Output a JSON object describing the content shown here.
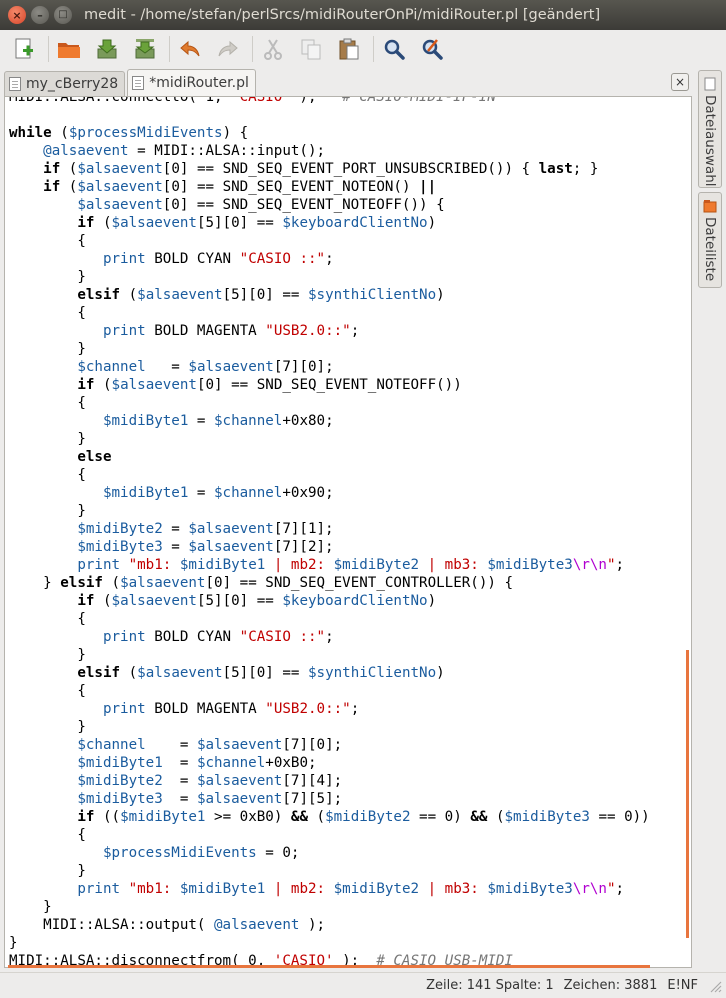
{
  "window": {
    "title": "medit - /home/stefan/perlSrcs/midiRouterOnPi/midiRouter.pl [geändert]",
    "close_glyph": "×",
    "min_glyph": "–",
    "max_glyph": "□"
  },
  "toolbar": {
    "icons": [
      "new-document-icon",
      "open-folder-icon",
      "save-icon",
      "save-as-icon",
      "undo-icon",
      "redo-icon",
      "cut-icon",
      "copy-icon",
      "paste-icon",
      "find-icon",
      "find-replace-icon"
    ]
  },
  "tabs": [
    {
      "label": "my_cBerry28"
    },
    {
      "label": "*midiRouter.pl"
    }
  ],
  "tab_close_glyph": "×",
  "side_panels": [
    {
      "label": "Dateiauswahl"
    },
    {
      "label": "Dateiliste"
    }
  ],
  "code_lines": [
    [
      [
        "",
        "MIDI::ALSA::connectto( 1, "
      ],
      [
        "str",
        "'CASIO'"
      ],
      [
        "",
        " );   "
      ],
      [
        "cmt",
        "# CASIO-MIDI-IF-IN"
      ]
    ],
    [],
    [
      [
        "kw",
        "while"
      ],
      [
        "",
        " ("
      ],
      [
        "var",
        "$processMidiEvents"
      ],
      [
        "",
        ") {"
      ]
    ],
    [
      [
        "",
        "    "
      ],
      [
        "var",
        "@alsaevent"
      ],
      [
        "",
        " = MIDI::ALSA::input();"
      ]
    ],
    [
      [
        "",
        "    "
      ],
      [
        "kw",
        "if"
      ],
      [
        "",
        " ("
      ],
      [
        "var",
        "$alsaevent"
      ],
      [
        "",
        "[0] == SND_SEQ_EVENT_PORT_UNSUBSCRIBED()) { "
      ],
      [
        "kw",
        "last"
      ],
      [
        "",
        "; }"
      ]
    ],
    [
      [
        "",
        "    "
      ],
      [
        "kw",
        "if"
      ],
      [
        "",
        " ("
      ],
      [
        "var",
        "$alsaevent"
      ],
      [
        "",
        "[0] == SND_SEQ_EVENT_NOTEON() "
      ],
      [
        "kw",
        "||"
      ]
    ],
    [
      [
        "",
        "        "
      ],
      [
        "var",
        "$alsaevent"
      ],
      [
        "",
        "[0] == SND_SEQ_EVENT_NOTEOFF()) {"
      ]
    ],
    [
      [
        "",
        "        "
      ],
      [
        "kw",
        "if"
      ],
      [
        "",
        " ("
      ],
      [
        "var",
        "$alsaevent"
      ],
      [
        "",
        "[5][0] == "
      ],
      [
        "var",
        "$keyboardClientNo"
      ],
      [
        "",
        ")"
      ]
    ],
    [
      [
        "",
        "        {"
      ]
    ],
    [
      [
        "",
        "           "
      ],
      [
        "var",
        "print"
      ],
      [
        "",
        " BOLD CYAN "
      ],
      [
        "str",
        "\"CASIO ::\""
      ],
      [
        "",
        ";"
      ]
    ],
    [
      [
        "",
        "        }"
      ]
    ],
    [
      [
        "",
        "        "
      ],
      [
        "kw",
        "elsif"
      ],
      [
        "",
        " ("
      ],
      [
        "var",
        "$alsaevent"
      ],
      [
        "",
        "[5][0] == "
      ],
      [
        "var",
        "$synthiClientNo"
      ],
      [
        "",
        ")"
      ]
    ],
    [
      [
        "",
        "        {"
      ]
    ],
    [
      [
        "",
        "           "
      ],
      [
        "var",
        "print"
      ],
      [
        "",
        " BOLD MAGENTA "
      ],
      [
        "str",
        "\"USB2.0::\""
      ],
      [
        "",
        ";"
      ]
    ],
    [
      [
        "",
        "        }"
      ]
    ],
    [
      [
        "",
        "        "
      ],
      [
        "var",
        "$channel"
      ],
      [
        "",
        "   = "
      ],
      [
        "var",
        "$alsaevent"
      ],
      [
        "",
        "[7][0];"
      ]
    ],
    [
      [
        "",
        "        "
      ],
      [
        "kw",
        "if"
      ],
      [
        "",
        " ("
      ],
      [
        "var",
        "$alsaevent"
      ],
      [
        "",
        "[0] == SND_SEQ_EVENT_NOTEOFF())"
      ]
    ],
    [
      [
        "",
        "        {"
      ]
    ],
    [
      [
        "",
        "           "
      ],
      [
        "var",
        "$midiByte1"
      ],
      [
        "",
        " = "
      ],
      [
        "var",
        "$channel"
      ],
      [
        "",
        "+0x80;"
      ]
    ],
    [
      [
        "",
        "        }"
      ]
    ],
    [
      [
        "",
        "        "
      ],
      [
        "kw",
        "else"
      ]
    ],
    [
      [
        "",
        "        {"
      ]
    ],
    [
      [
        "",
        "           "
      ],
      [
        "var",
        "$midiByte1"
      ],
      [
        "",
        " = "
      ],
      [
        "var",
        "$channel"
      ],
      [
        "",
        "+0x90;"
      ]
    ],
    [
      [
        "",
        "        }"
      ]
    ],
    [
      [
        "",
        "        "
      ],
      [
        "var",
        "$midiByte2"
      ],
      [
        "",
        " = "
      ],
      [
        "var",
        "$alsaevent"
      ],
      [
        "",
        "[7][1];"
      ]
    ],
    [
      [
        "",
        "        "
      ],
      [
        "var",
        "$midiByte3"
      ],
      [
        "",
        " = "
      ],
      [
        "var",
        "$alsaevent"
      ],
      [
        "",
        "[7][2];"
      ]
    ],
    [
      [
        "",
        "        "
      ],
      [
        "var",
        "print"
      ],
      [
        "",
        ""
      ],
      [
        "str",
        " \"mb1: "
      ],
      [
        "var",
        "$midiByte1"
      ],
      [
        "str",
        " | mb2: "
      ],
      [
        "var",
        "$midiByte2"
      ],
      [
        "str",
        " | mb3: "
      ],
      [
        "var",
        "$midiByte3"
      ],
      [
        "esc",
        "\\r\\n"
      ],
      [
        "str",
        "\""
      ],
      [
        "",
        ";"
      ]
    ],
    [
      [
        "",
        "    } "
      ],
      [
        "kw",
        "elsif"
      ],
      [
        "",
        " ("
      ],
      [
        "var",
        "$alsaevent"
      ],
      [
        "",
        "[0] == SND_SEQ_EVENT_CONTROLLER()) {"
      ]
    ],
    [
      [
        "",
        "        "
      ],
      [
        "kw",
        "if"
      ],
      [
        "",
        " ("
      ],
      [
        "var",
        "$alsaevent"
      ],
      [
        "",
        "[5][0] == "
      ],
      [
        "var",
        "$keyboardClientNo"
      ],
      [
        "",
        ")"
      ]
    ],
    [
      [
        "",
        "        {"
      ]
    ],
    [
      [
        "",
        "           "
      ],
      [
        "var",
        "print"
      ],
      [
        "",
        " BOLD CYAN "
      ],
      [
        "str",
        "\"CASIO ::\""
      ],
      [
        "",
        ";"
      ]
    ],
    [
      [
        "",
        "        }"
      ]
    ],
    [
      [
        "",
        "        "
      ],
      [
        "kw",
        "elsif"
      ],
      [
        "",
        " ("
      ],
      [
        "var",
        "$alsaevent"
      ],
      [
        "",
        "[5][0] == "
      ],
      [
        "var",
        "$synthiClientNo"
      ],
      [
        "",
        ")"
      ]
    ],
    [
      [
        "",
        "        {"
      ]
    ],
    [
      [
        "",
        "           "
      ],
      [
        "var",
        "print"
      ],
      [
        "",
        " BOLD MAGENTA "
      ],
      [
        "str",
        "\"USB2.0::\""
      ],
      [
        "",
        ";"
      ]
    ],
    [
      [
        "",
        "        }"
      ]
    ],
    [
      [
        "",
        "        "
      ],
      [
        "var",
        "$channel"
      ],
      [
        "",
        "    = "
      ],
      [
        "var",
        "$alsaevent"
      ],
      [
        "",
        "[7][0];"
      ]
    ],
    [
      [
        "",
        "        "
      ],
      [
        "var",
        "$midiByte1"
      ],
      [
        "",
        "  = "
      ],
      [
        "var",
        "$channel"
      ],
      [
        "",
        "+0xB0;"
      ]
    ],
    [
      [
        "",
        "        "
      ],
      [
        "var",
        "$midiByte2"
      ],
      [
        "",
        "  = "
      ],
      [
        "var",
        "$alsaevent"
      ],
      [
        "",
        "[7][4];"
      ]
    ],
    [
      [
        "",
        "        "
      ],
      [
        "var",
        "$midiByte3"
      ],
      [
        "",
        "  = "
      ],
      [
        "var",
        "$alsaevent"
      ],
      [
        "",
        "[7][5];"
      ]
    ],
    [
      [
        "",
        "        "
      ],
      [
        "kw",
        "if"
      ],
      [
        "",
        " (("
      ],
      [
        "var",
        "$midiByte1"
      ],
      [
        "",
        " >= 0xB0) "
      ],
      [
        "kw",
        "&&"
      ],
      [
        "",
        " ("
      ],
      [
        "var",
        "$midiByte2"
      ],
      [
        "",
        " == 0) "
      ],
      [
        "kw",
        "&&"
      ],
      [
        "",
        " ("
      ],
      [
        "var",
        "$midiByte3"
      ],
      [
        "",
        " == 0))"
      ]
    ],
    [
      [
        "",
        "        {"
      ]
    ],
    [
      [
        "",
        "           "
      ],
      [
        "var",
        "$processMidiEvents"
      ],
      [
        "",
        " = 0;"
      ]
    ],
    [
      [
        "",
        "        }"
      ]
    ],
    [
      [
        "",
        "        "
      ],
      [
        "var",
        "print"
      ],
      [
        "",
        ""
      ],
      [
        "str",
        " \"mb1: "
      ],
      [
        "var",
        "$midiByte1"
      ],
      [
        "str",
        " | mb2: "
      ],
      [
        "var",
        "$midiByte2"
      ],
      [
        "str",
        " | mb3: "
      ],
      [
        "var",
        "$midiByte3"
      ],
      [
        "esc",
        "\\r\\n"
      ],
      [
        "str",
        "\""
      ],
      [
        "",
        ";"
      ]
    ],
    [
      [
        "",
        "    }"
      ]
    ],
    [
      [
        "",
        "    MIDI::ALSA::output( "
      ],
      [
        "var",
        "@alsaevent"
      ],
      [
        "",
        " );"
      ]
    ],
    [
      [
        "",
        "}"
      ]
    ],
    [
      [
        "",
        "MIDI::ALSA::disconnectfrom( 0, "
      ],
      [
        "str",
        "'CASIO'"
      ],
      [
        "",
        " );  "
      ],
      [
        "cmt",
        "# CASIO USB-MIDI"
      ]
    ]
  ],
  "current_line_index": 49,
  "statusbar": {
    "position": "Zeile: 141 Spalte: 1",
    "chars": "Zeichen: 3881",
    "mode": "E!NF"
  }
}
